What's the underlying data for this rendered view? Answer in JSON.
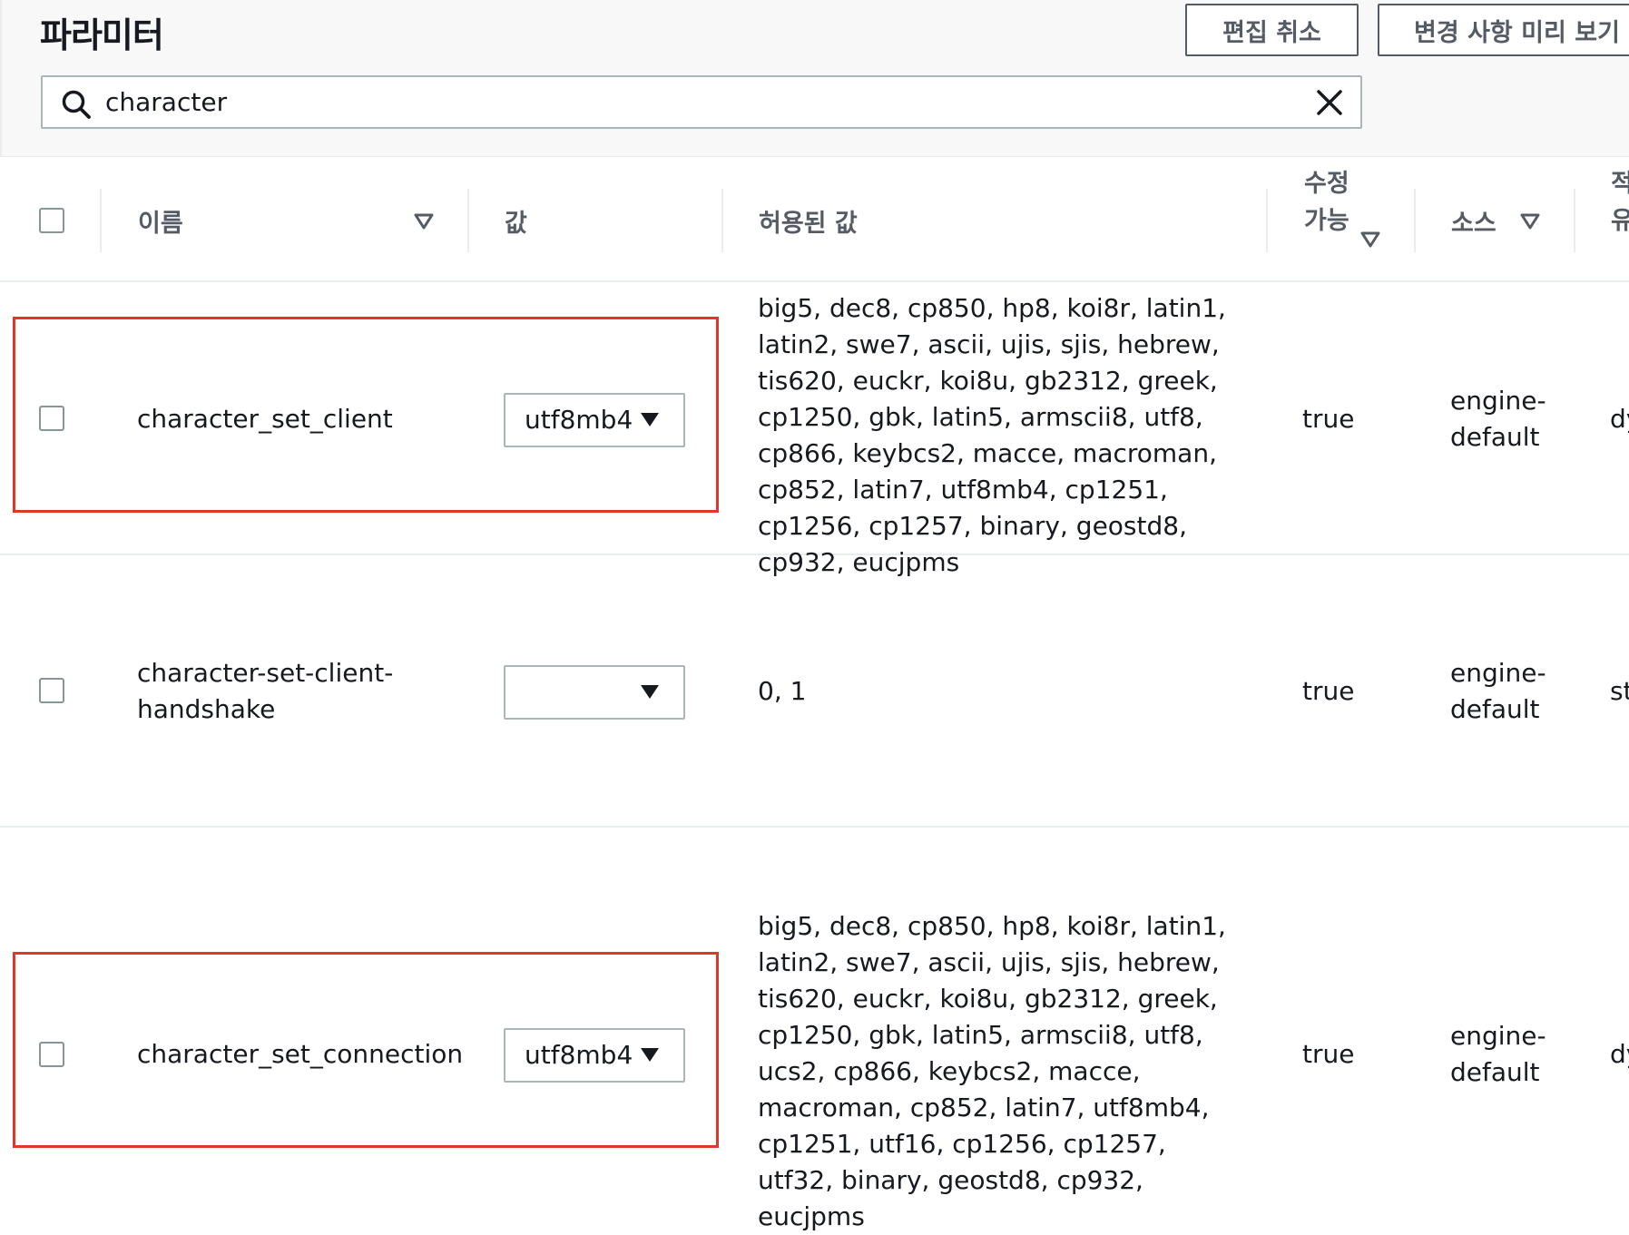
{
  "header": {
    "title": "파라미터",
    "cancel_label": "편집 취소",
    "preview_label": "변경 사항 미리 보기"
  },
  "search": {
    "value": "character",
    "icon": "search-icon",
    "clear_icon": "close-icon"
  },
  "columns": {
    "name": "이름",
    "value": "값",
    "allowed": "허용된 값",
    "modifiable_line1": "수정",
    "modifiable_line2": "가능",
    "source": "소스",
    "apply_type_line1": "적",
    "apply_type_line2": "유"
  },
  "rows": [
    {
      "name": "character_set_client",
      "value": "utf8mb4",
      "allowed": "big5, dec8, cp850, hp8, koi8r, latin1, latin2, swe7, ascii, ujis, sjis, hebrew, tis620, euckr, koi8u, gb2312, greek, cp1250, gbk, latin5, armscii8, utf8, cp866, keybcs2, macce, macroman, cp852, latin7, utf8mb4, cp1251, cp1256, cp1257, binary, geostd8, cp932, eucjpms",
      "modifiable": "true",
      "source": "engine-default",
      "apply_type": "dy",
      "highlighted": true
    },
    {
      "name": "character-set-client-handshake",
      "value": "",
      "allowed": "0, 1",
      "modifiable": "true",
      "source": "engine-default",
      "apply_type": "st",
      "highlighted": false
    },
    {
      "name": "character_set_connection",
      "value": "utf8mb4",
      "allowed": "big5, dec8, cp850, hp8, koi8r, latin1, latin2, swe7, ascii, ujis, sjis, hebrew, tis620, euckr, koi8u, gb2312, greek, cp1250, gbk, latin5, armscii8, utf8, ucs2, cp866, keybcs2, macce, macroman, cp852, latin7, utf8mb4, cp1251, utf16, cp1256, cp1257, utf32, binary, geostd8, cp932, eucjpms",
      "modifiable": "true",
      "source": "engine-default",
      "apply_type": "dy",
      "highlighted": true
    }
  ],
  "colors": {
    "highlight_border": "#e0372a",
    "header_bg": "#f8f8f8",
    "border": "#aab7b8"
  }
}
